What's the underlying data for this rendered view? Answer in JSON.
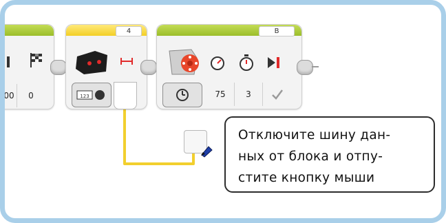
{
  "block_left": {
    "values": [
      "00",
      "0"
    ]
  },
  "block_sensor": {
    "port": "4"
  },
  "block_motor": {
    "port": "B",
    "values": [
      "75",
      "3"
    ]
  },
  "callout": {
    "lines": [
      "Отключите шину дан-",
      "ных от блока и отпу-",
      "стите кнопку мыши"
    ]
  },
  "colors": {
    "frame": "#a9cfe9",
    "block_header_green": "#a9c63a",
    "block_header_yellow": "#f6d83a",
    "data_wire": "#f2cf2e",
    "icon_red": "#e12a2a"
  },
  "icons": [
    "bars-icon",
    "checkered-flag-icon",
    "ultrasonic-sensor-icon",
    "distance-arrows-icon",
    "compare-mode-icon",
    "large-motor-icon",
    "speed-gauge-icon",
    "stopwatch-icon",
    "brake-stop-icon",
    "rotations-mode-icon",
    "check-icon",
    "wire-endpoint-icon",
    "cursor-pointer-icon"
  ]
}
